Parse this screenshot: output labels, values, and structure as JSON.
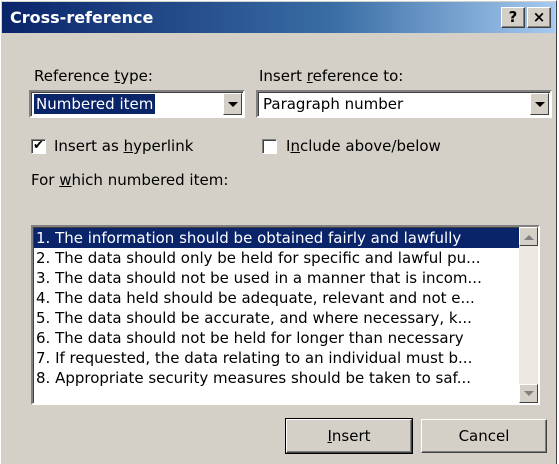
{
  "dialog": {
    "title": "Cross-reference",
    "help_glyph": "?",
    "close_glyph": "×"
  },
  "reference_type": {
    "label_pre": "Reference ",
    "label_key": "t",
    "label_post": "ype:",
    "value": "Numbered item"
  },
  "insert_reference": {
    "label_pre": "Insert ",
    "label_key": "r",
    "label_post": "eference to:",
    "value": "Paragraph number"
  },
  "insert_hyperlink": {
    "checked": true,
    "check_glyph": "✔",
    "label_pre": "Insert as ",
    "label_key": "h",
    "label_post": "yperlink"
  },
  "include_above_below": {
    "checked": false,
    "label_pre": "I",
    "label_key": "n",
    "label_post": "clude above/below"
  },
  "which_item": {
    "label_pre": "For ",
    "label_key": "w",
    "label_post": "hich numbered item:"
  },
  "items": [
    "1. The information should be obtained fairly and lawfully",
    "2. The data should only be held for specific and lawful pu...",
    "3. The data should not be used in a manner that is incom...",
    "4. The data held should be adequate, relevant and not e...",
    "5. The data should be accurate, and where necessary, k...",
    "6. The data should not be held for longer than necessary",
    "7. If requested, the data relating to an individual must b...",
    "8. Appropriate security measures should be taken to saf..."
  ],
  "selected_item_index": 0,
  "buttons": {
    "insert_key": "I",
    "insert_rest": "nsert",
    "cancel": "Cancel"
  },
  "icons": [
    "help-icon",
    "close-icon",
    "dropdown-arrow-icon",
    "checkmark-icon",
    "scroll-up-icon",
    "scroll-down-icon"
  ]
}
